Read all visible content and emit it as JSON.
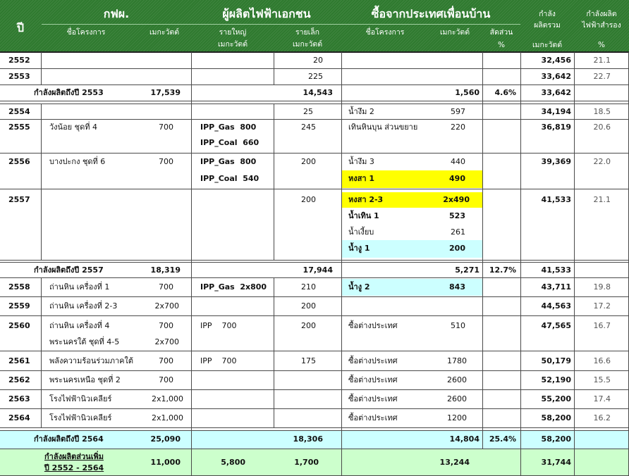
{
  "header": {
    "col_year": "ปี",
    "egat": "กฟผ.",
    "ipp": "ผู้ผลิตไฟฟ้าเอกชน",
    "neighbor": "ซื้อจากประเทศเพื่อนบ้าน",
    "total_top": "กำลัง",
    "total_mid": "ผลิตรวม",
    "total_unit": "เมกะวัตต์",
    "reserve_top": "กำลังผลิต",
    "reserve_mid": "ไฟฟ้าสำรอง",
    "reserve_unit": "%",
    "egat_project": "ชื่อโครงการ",
    "egat_mw": "เมกะวัตต์",
    "ipp_large_1": "รายใหญ่",
    "ipp_large_2": "เมกะวัตต์",
    "ipp_small_1": "รายเล็ก",
    "ipp_small_2": "เมกะวัตต์",
    "nb_project": "ชื่อโครงการ",
    "nb_mw": "เมกะวัตต์",
    "nb_share_1": "สัดส่วน",
    "nb_share_2": "%"
  },
  "rows": {
    "r2552": {
      "year": "2552",
      "spp": "20",
      "total": "32,456",
      "reserve": "21.1"
    },
    "r2553": {
      "year": "2553",
      "spp": "225",
      "total": "33,642",
      "reserve": "22.7"
    },
    "sub2553": {
      "label": "กำลังผลิตถึงปี 2553",
      "egat": "17,539",
      "spp": "14,543",
      "nb": "1,560",
      "share": "4.6%",
      "total": "33,642"
    },
    "r2554": {
      "year": "2554",
      "spp": "25",
      "nb1_name": "น้ำงึม 2",
      "nb1_mw": "597",
      "total": "34,194",
      "reserve": "18.5"
    },
    "r2555": {
      "year": "2555",
      "egat1_name": "วังน้อย ชุดที่ 4",
      "egat1_mw": "700",
      "ipp1": "IPP_Gas  800",
      "ipp2": "IPP_Coal  660",
      "spp": "245",
      "nb1_name": "เทินหินบุน ส่วนขยาย",
      "nb1_mw": "220",
      "total": "36,819",
      "reserve": "20.6"
    },
    "r2556": {
      "year": "2556",
      "egat1_name": "บางปะกง ชุดที่ 6",
      "egat1_mw": "700",
      "ipp1": "IPP_Gas  800",
      "ipp2": "IPP_Coal  540",
      "spp": "200",
      "nb1_name": "น้ำงึม 3",
      "nb1_mw": "440",
      "nb2_name": "หงสา 1",
      "nb2_mw": "490",
      "total": "39,369",
      "reserve": "22.0"
    },
    "r2557": {
      "year": "2557",
      "spp": "200",
      "nb1_name": "หงสา 2-3",
      "nb1_mw": "2x490",
      "nb2_name": "น้ำเทิน 1",
      "nb2_mw": "523",
      "nb3_name": "น้ำเงี้ยบ",
      "nb3_mw": "261",
      "nb4_name": "น้ำงู 1",
      "nb4_mw": "200",
      "total": "41,533",
      "reserve": "21.1"
    },
    "sub2557": {
      "label": "กำลังผลิตถึงปี 2557",
      "egat": "18,319",
      "spp": "17,944",
      "nb": "5,271",
      "share": "12.7%",
      "total": "41,533"
    },
    "r2558": {
      "year": "2558",
      "egat1_name": "ถ่านหิน เครื่องที่ 1",
      "egat1_mw": "700",
      "ipp1": "IPP_Gas  2x800",
      "spp": "210",
      "nb1_name": "น้ำงู 2",
      "nb1_mw": "843",
      "total": "43,711",
      "reserve": "19.8"
    },
    "r2559": {
      "year": "2559",
      "egat1_name": "ถ่านหิน เครื่องที่ 2-3",
      "egat1_mw": "2x700",
      "spp": "200",
      "total": "44,563",
      "reserve": "17.2"
    },
    "r2560": {
      "year": "2560",
      "egat1_name": "ถ่านหิน เครื่องที่ 4",
      "egat1_mw": "700",
      "egat2_name": "พระนครใต้ ชุดที่ 4-5",
      "egat2_mw": "2x700",
      "ipp1": "IPP    700",
      "spp": "200",
      "nb1_name": "ซื้อต่างประเทศ",
      "nb1_mw": "510",
      "total": "47,565",
      "reserve": "16.7"
    },
    "r2561": {
      "year": "2561",
      "egat1_name": "พลังความร้อนร่วมภาคใต้",
      "egat1_mw": "700",
      "ipp1": "IPP    700",
      "spp": "175",
      "nb1_name": "ซื้อต่างประเทศ",
      "nb1_mw": "1780",
      "total": "50,179",
      "reserve": "16.6"
    },
    "r2562": {
      "year": "2562",
      "egat1_name": "พระนครเหนือ ชุดที่ 2",
      "egat1_mw": "700",
      "nb1_name": "ซื้อต่างประเทศ",
      "nb1_mw": "2600",
      "total": "52,190",
      "reserve": "15.5"
    },
    "r2563": {
      "year": "2563",
      "egat1_name": "โรงไฟฟ้านิวเคลียร์",
      "egat1_mw": "2x1,000",
      "nb1_name": "ซื้อต่างประเทศ",
      "nb1_mw": "2600",
      "total": "55,200",
      "reserve": "17.4"
    },
    "r2564": {
      "year": "2564",
      "egat1_name": "โรงไฟฟ้านิวเคลียร์",
      "egat1_mw": "2x1,000",
      "nb1_name": "ซื้อต่างประเทศ",
      "nb1_mw": "1200",
      "total": "58,200",
      "reserve": "16.2"
    },
    "sub2564": {
      "label": "กำลังผลิตถึงปี 2564",
      "egat": "25,090",
      "spp": "18,306",
      "nb": "14,804",
      "share": "25.4%",
      "total": "58,200"
    },
    "added": {
      "label1": "กำลังผลิตส่วนเพิ่ม",
      "label2": "ปี 2552 - 2564",
      "egat": "11,000",
      "ipp": "5,800",
      "spp": "1,700",
      "nb": "13,244",
      "total": "31,744"
    }
  },
  "colors": {
    "header_green": "#2f7a2f",
    "highlight_yellow": "#ffff00",
    "highlight_cyan": "#ccffff",
    "subtotal_cyan": "#ccffff",
    "added_green": "#ccffcc"
  }
}
